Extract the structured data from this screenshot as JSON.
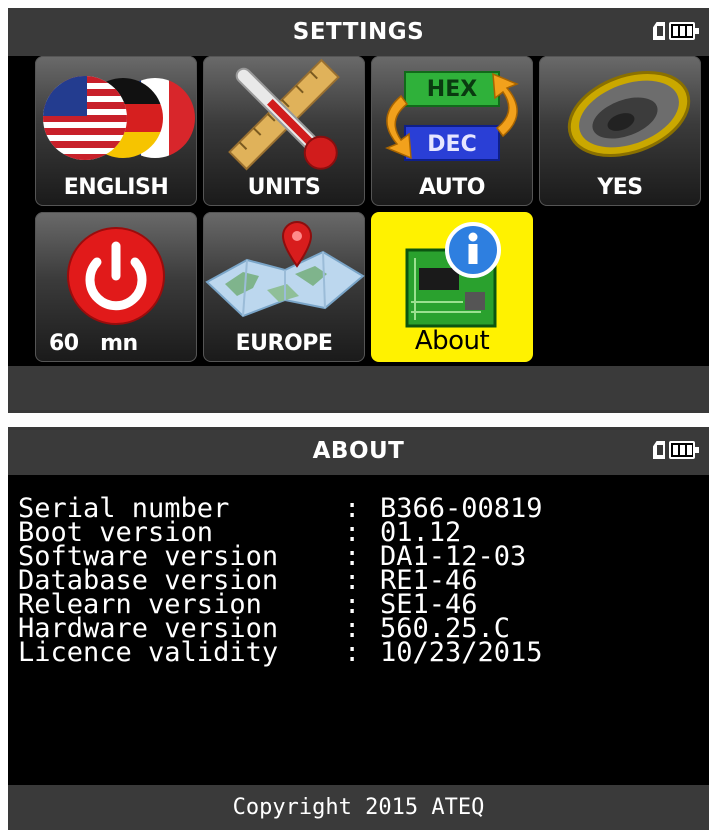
{
  "settings_screen": {
    "title": "SETTINGS",
    "tiles": [
      {
        "label": "ENGLISH",
        "icon": "flags-icon"
      },
      {
        "label": "UNITS",
        "icon": "thermometer-ruler-icon"
      },
      {
        "label": "AUTO",
        "icon": "hex-dec-icon",
        "hex": "HEX",
        "dec": "DEC"
      },
      {
        "label": "YES",
        "icon": "speaker-icon"
      },
      {
        "label": "60   mn",
        "icon": "power-icon"
      },
      {
        "label": "EUROPE",
        "icon": "map-icon"
      },
      {
        "label": "About",
        "icon": "info-board-icon",
        "selected": true
      }
    ]
  },
  "about_screen": {
    "title": "ABOUT",
    "rows": [
      {
        "key": "Serial number",
        "value": "B366-00819"
      },
      {
        "key": "Boot version",
        "value": "01.12"
      },
      {
        "key": "Software version",
        "value": "DA1-12-03"
      },
      {
        "key": "Database version",
        "value": "RE1-46"
      },
      {
        "key": "Relearn version",
        "value": "SE1-46"
      },
      {
        "key": "Hardware version",
        "value": "560.25.C"
      },
      {
        "key": "Licence validity",
        "value": "10/23/2015"
      }
    ],
    "footer": "Copyright 2015 ATEQ",
    "separator": ":"
  },
  "colors": {
    "title_bar": "#3a3a3a",
    "selected_tile": "#fff200"
  }
}
